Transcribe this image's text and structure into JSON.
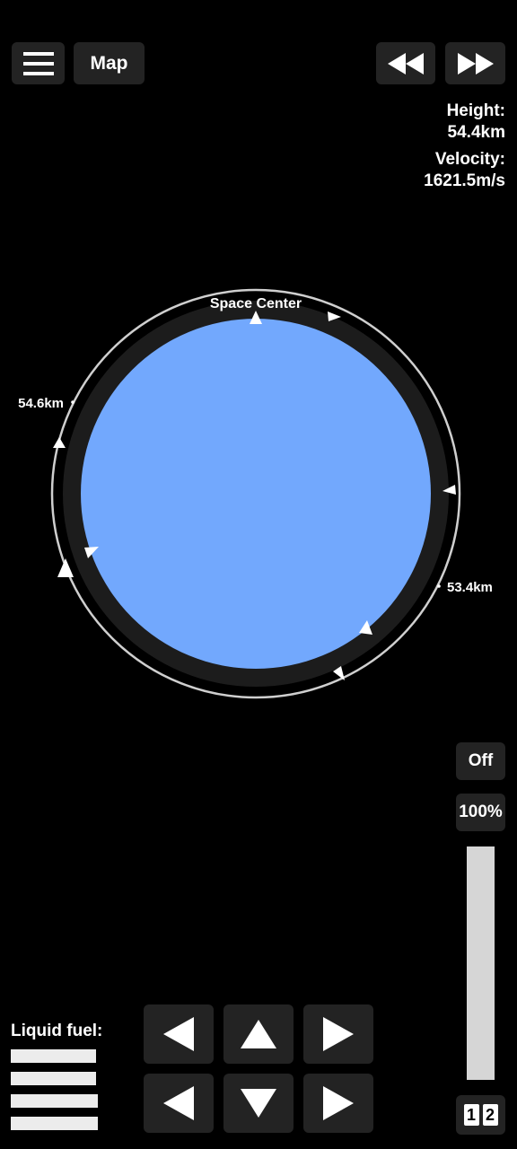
{
  "toolbar": {
    "menu_icon": "hamburger-menu-icon",
    "map_label": "Map",
    "rewind_icon": "rewind-icon",
    "fast_forward_icon": "fast-forward-icon"
  },
  "telemetry": {
    "height_label": "Height:",
    "height_value": "54.4km",
    "velocity_label": "Velocity:",
    "velocity_value": "1621.5m/s"
  },
  "map": {
    "location_label": "Space Center",
    "apoapsis_label": "54.6km",
    "periapsis_label": "53.4km",
    "planet_color": "#72a8fd",
    "atmosphere_color": "#1c1c1c",
    "orbit_color": "#cfcfcf"
  },
  "controls": {
    "rcs_label": "Off",
    "throttle_label": "100%",
    "throttle_level": 1.0,
    "stage_numbers": [
      "1",
      "2"
    ],
    "fuel_label": "Liquid fuel:",
    "fuel_levels": [
      0.88,
      0.88,
      0.9,
      0.9
    ]
  }
}
